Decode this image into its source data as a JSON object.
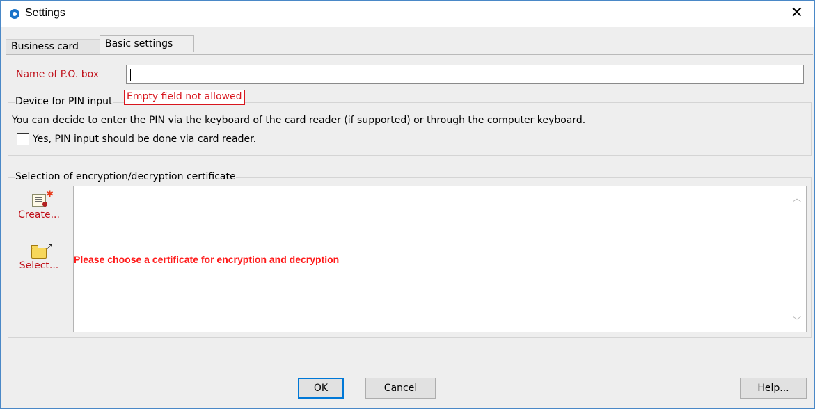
{
  "window": {
    "title": "Settings",
    "close_glyph": "✕",
    "icon": "app-logo-icon"
  },
  "tabs": [
    {
      "label": "Business card",
      "active": false
    },
    {
      "label": "Basic settings",
      "active": true
    }
  ],
  "po_box": {
    "label": "Name of P.O. box",
    "value": "",
    "error_tooltip": "Empty field not allowed"
  },
  "pin_group": {
    "title": "Device for PIN input",
    "description": "You can decide to enter the PIN via the keyboard of the card reader (if supported) or through the computer keyboard.",
    "checkbox_label": "Yes, PIN input should be done via card reader.",
    "checked": false
  },
  "cert_group": {
    "title": "Selection of encryption/decryption certificate",
    "create_label": "Create...",
    "select_label": "Select...",
    "message": "Please choose a certificate for encryption and decryption",
    "create_icon": "certificate-icon",
    "select_icon": "open-folder-icon"
  },
  "buttons": {
    "ok_mnemonic": "O",
    "ok_rest": "K",
    "cancel_mnemonic": "C",
    "cancel_rest": "ancel",
    "help_mnemonic": "H",
    "help_rest": "elp..."
  },
  "colors": {
    "error_red": "#c0121c",
    "message_red": "#ff1a1a",
    "focus_blue": "#0078d7"
  }
}
